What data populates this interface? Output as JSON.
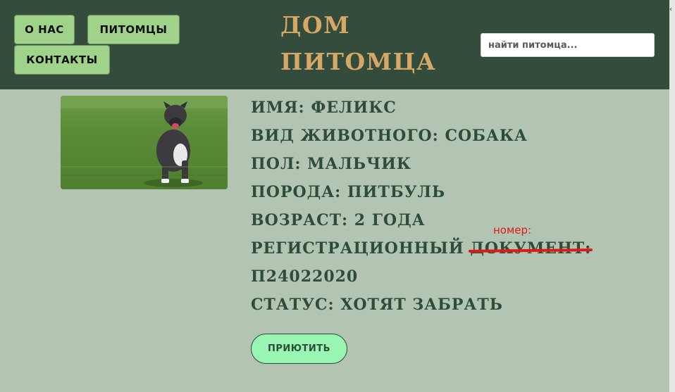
{
  "nav": {
    "about_label": "О НАС",
    "pets_label": "ПИТОМЦЫ",
    "contacts_label": "КОНТАКТЫ"
  },
  "header": {
    "title": "ДОМ\nПИТОМЦА"
  },
  "search": {
    "placeholder": "найти питомца..."
  },
  "pet": {
    "photo_description": "dog-photo",
    "name_line": "ИМЯ: ФЕЛИКС",
    "species_line": "ВИД ЖИВОТНОГО: СОБАКА",
    "sex_line": "ПОЛ: МАЛЬЧИК",
    "breed_line": "ПОРОДА: ПИТБУЛЬ",
    "age_line": "ВОЗРАСТ: 2 ГОДА",
    "reg_prefix": "РЕГИСТРАЦИОННЫЙ",
    "reg_struck": "ДОКУМЕНТ:",
    "reg_note": "номер:",
    "reg_value": "П24022020",
    "status_line": "СТАТУС: ХОТЯТ ЗАБРАТЬ"
  },
  "actions": {
    "adopt_label": "ПРИЮТИТЬ"
  },
  "colors": {
    "background": "#b3c4b3",
    "header": "#344c3c",
    "nav_button": "#9fd38a",
    "title": "#d7a766",
    "text": "#2f4b3a",
    "adopt_button": "#98f5b2",
    "strike": "#e01818"
  }
}
